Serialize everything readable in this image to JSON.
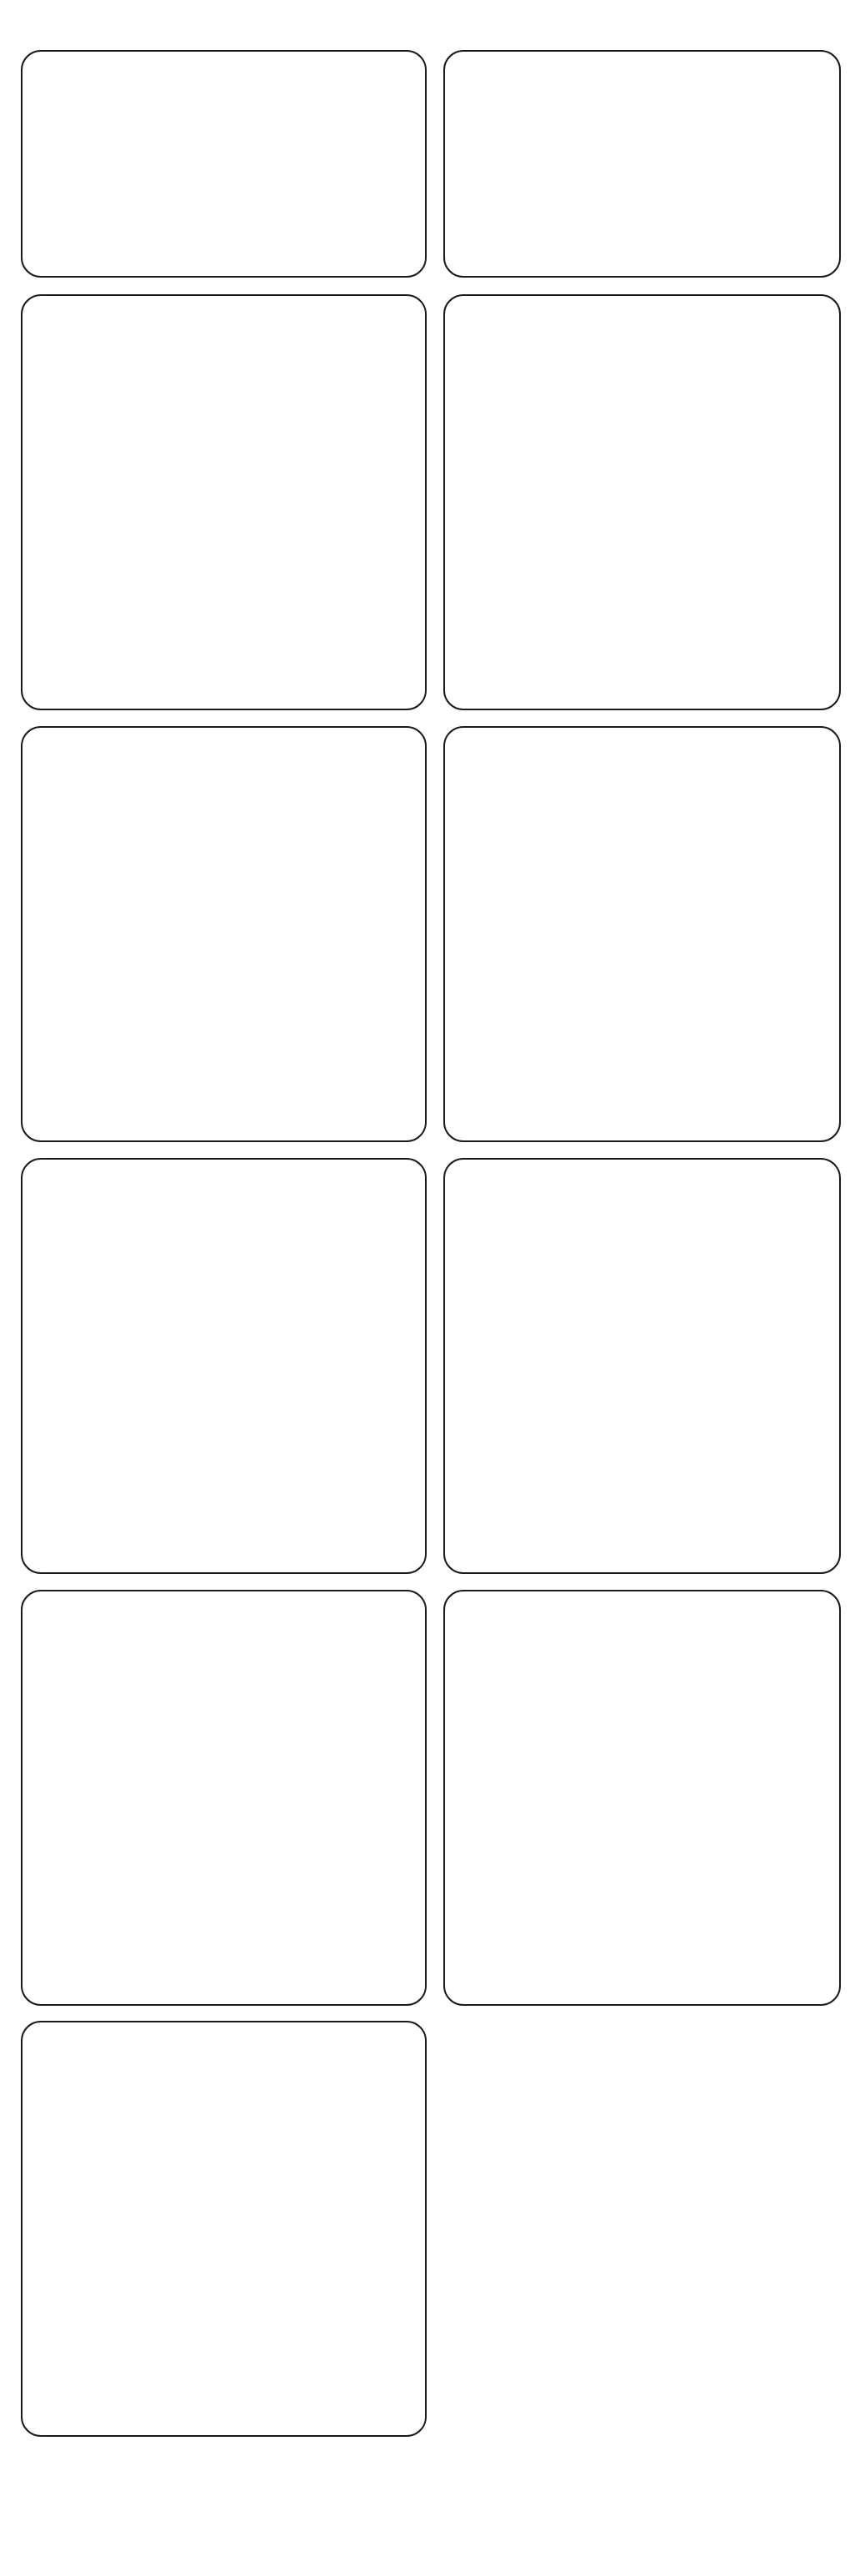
{
  "cards": [
    {
      "id": "card-1"
    },
    {
      "id": "card-2"
    },
    {
      "id": "card-3"
    },
    {
      "id": "card-4"
    },
    {
      "id": "card-5"
    },
    {
      "id": "card-6"
    },
    {
      "id": "card-7"
    },
    {
      "id": "card-8"
    },
    {
      "id": "card-9"
    },
    {
      "id": "card-10"
    },
    {
      "id": "card-11"
    }
  ]
}
